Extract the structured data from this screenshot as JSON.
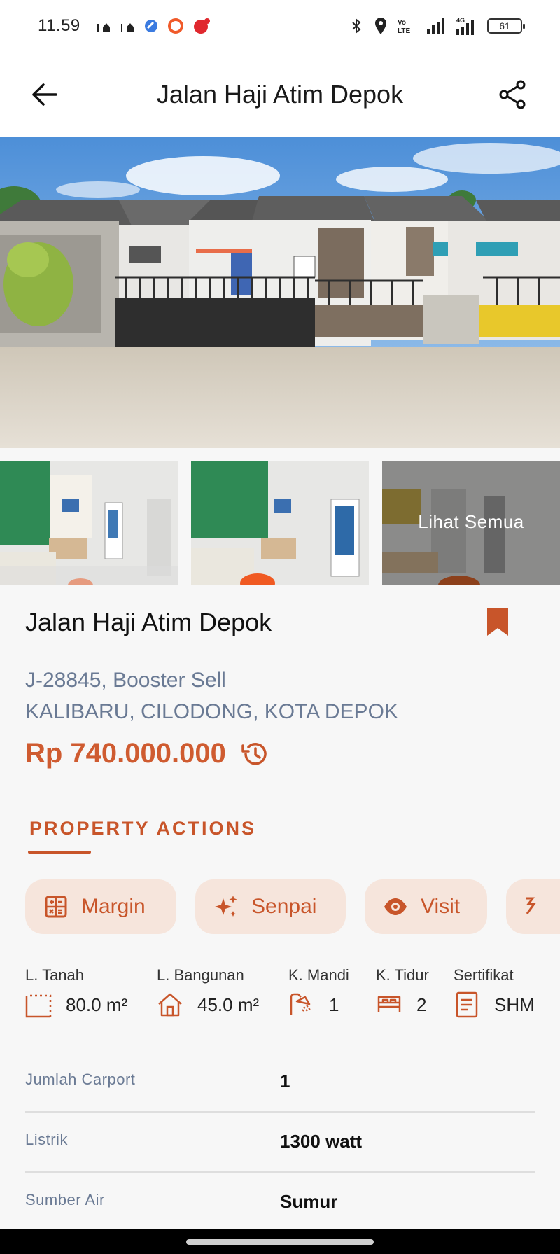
{
  "status_bar": {
    "time": "11.59",
    "battery": "61"
  },
  "app_bar": {
    "title": "Jalan Haji Atim Depok"
  },
  "gallery": {
    "see_all_label": "Lihat Semua"
  },
  "listing": {
    "title": "Jalan Haji Atim Depok",
    "code": "J-28845, Booster Sell",
    "location": "KALIBARU, CILODONG, KOTA DEPOK",
    "price": "Rp 740.000.000"
  },
  "actions_section": {
    "heading": "PROPERTY ACTIONS",
    "buttons": [
      {
        "label": "Margin",
        "icon": "calculator-icon"
      },
      {
        "label": "Senpai",
        "icon": "sparkle-icon"
      },
      {
        "label": "Visit",
        "icon": "eye-icon"
      }
    ]
  },
  "specs": [
    {
      "label": "L. Tanah",
      "value": "80.0 m²",
      "icon": "land-area-icon"
    },
    {
      "label": "L. Bangunan",
      "value": "45.0 m²",
      "icon": "house-icon"
    },
    {
      "label": "K. Mandi",
      "value": "1",
      "icon": "shower-icon"
    },
    {
      "label": "K. Tidur",
      "value": "2",
      "icon": "bed-icon"
    },
    {
      "label": "Sertifikat",
      "value": "SHM",
      "icon": "document-icon"
    }
  ],
  "details": [
    {
      "key": "Jumlah Carport",
      "value": "1"
    },
    {
      "key": "Listrik",
      "value": "1300 watt"
    },
    {
      "key": "Sumber Air",
      "value": "Sumur"
    }
  ],
  "colors": {
    "accent": "#c8552a",
    "chip_bg": "#f6e5dc",
    "muted_text": "#6a7a94"
  }
}
